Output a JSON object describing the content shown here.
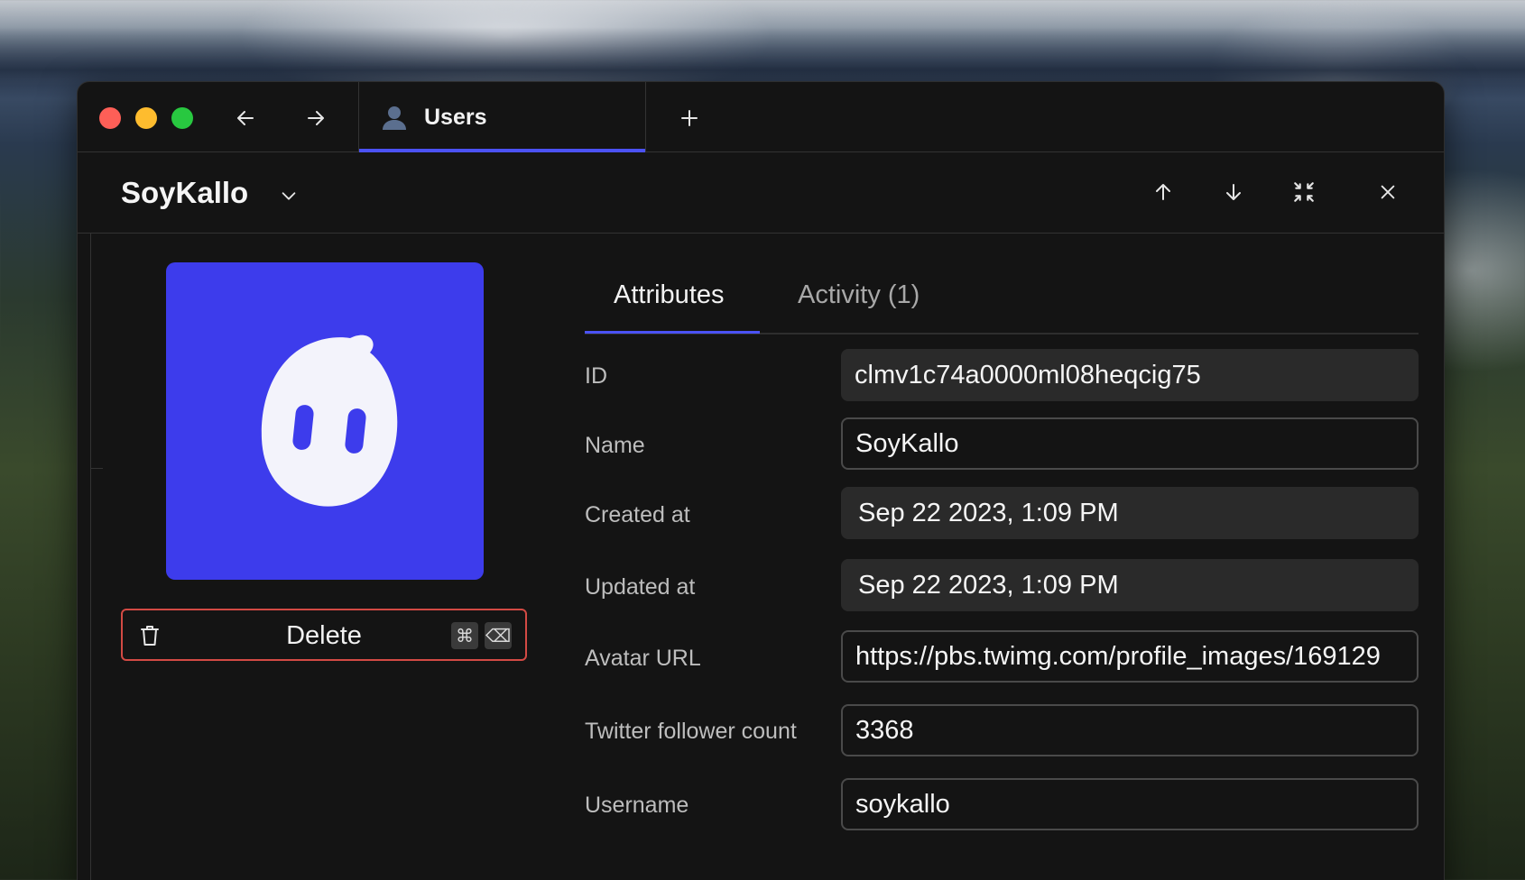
{
  "window": {
    "tab_label": "Users"
  },
  "header": {
    "record_title": "SoyKallo"
  },
  "delete_button": {
    "label": "Delete",
    "shortcut_cmd": "⌘",
    "shortcut_del": "⌫"
  },
  "panel_tabs": [
    {
      "label": "Attributes"
    },
    {
      "label": "Activity (1)"
    }
  ],
  "fields": [
    {
      "label": "ID",
      "value": "clmv1c74a0000ml08heqcig75"
    },
    {
      "label": "Name",
      "value": "SoyKallo"
    },
    {
      "label": "Created at",
      "value": "Sep 22 2023, 1:09 PM"
    },
    {
      "label": "Updated at",
      "value": "Sep 22 2023, 1:09 PM"
    },
    {
      "label": "Avatar URL",
      "value": "https://pbs.twimg.com/profile_images/169129"
    },
    {
      "label": "Twitter follower count",
      "value": "3368"
    },
    {
      "label": "Username",
      "value": "soykallo"
    }
  ],
  "colors": {
    "accent": "#4b52f5",
    "avatar_bg": "#3d3cec",
    "danger": "#d34a44"
  }
}
